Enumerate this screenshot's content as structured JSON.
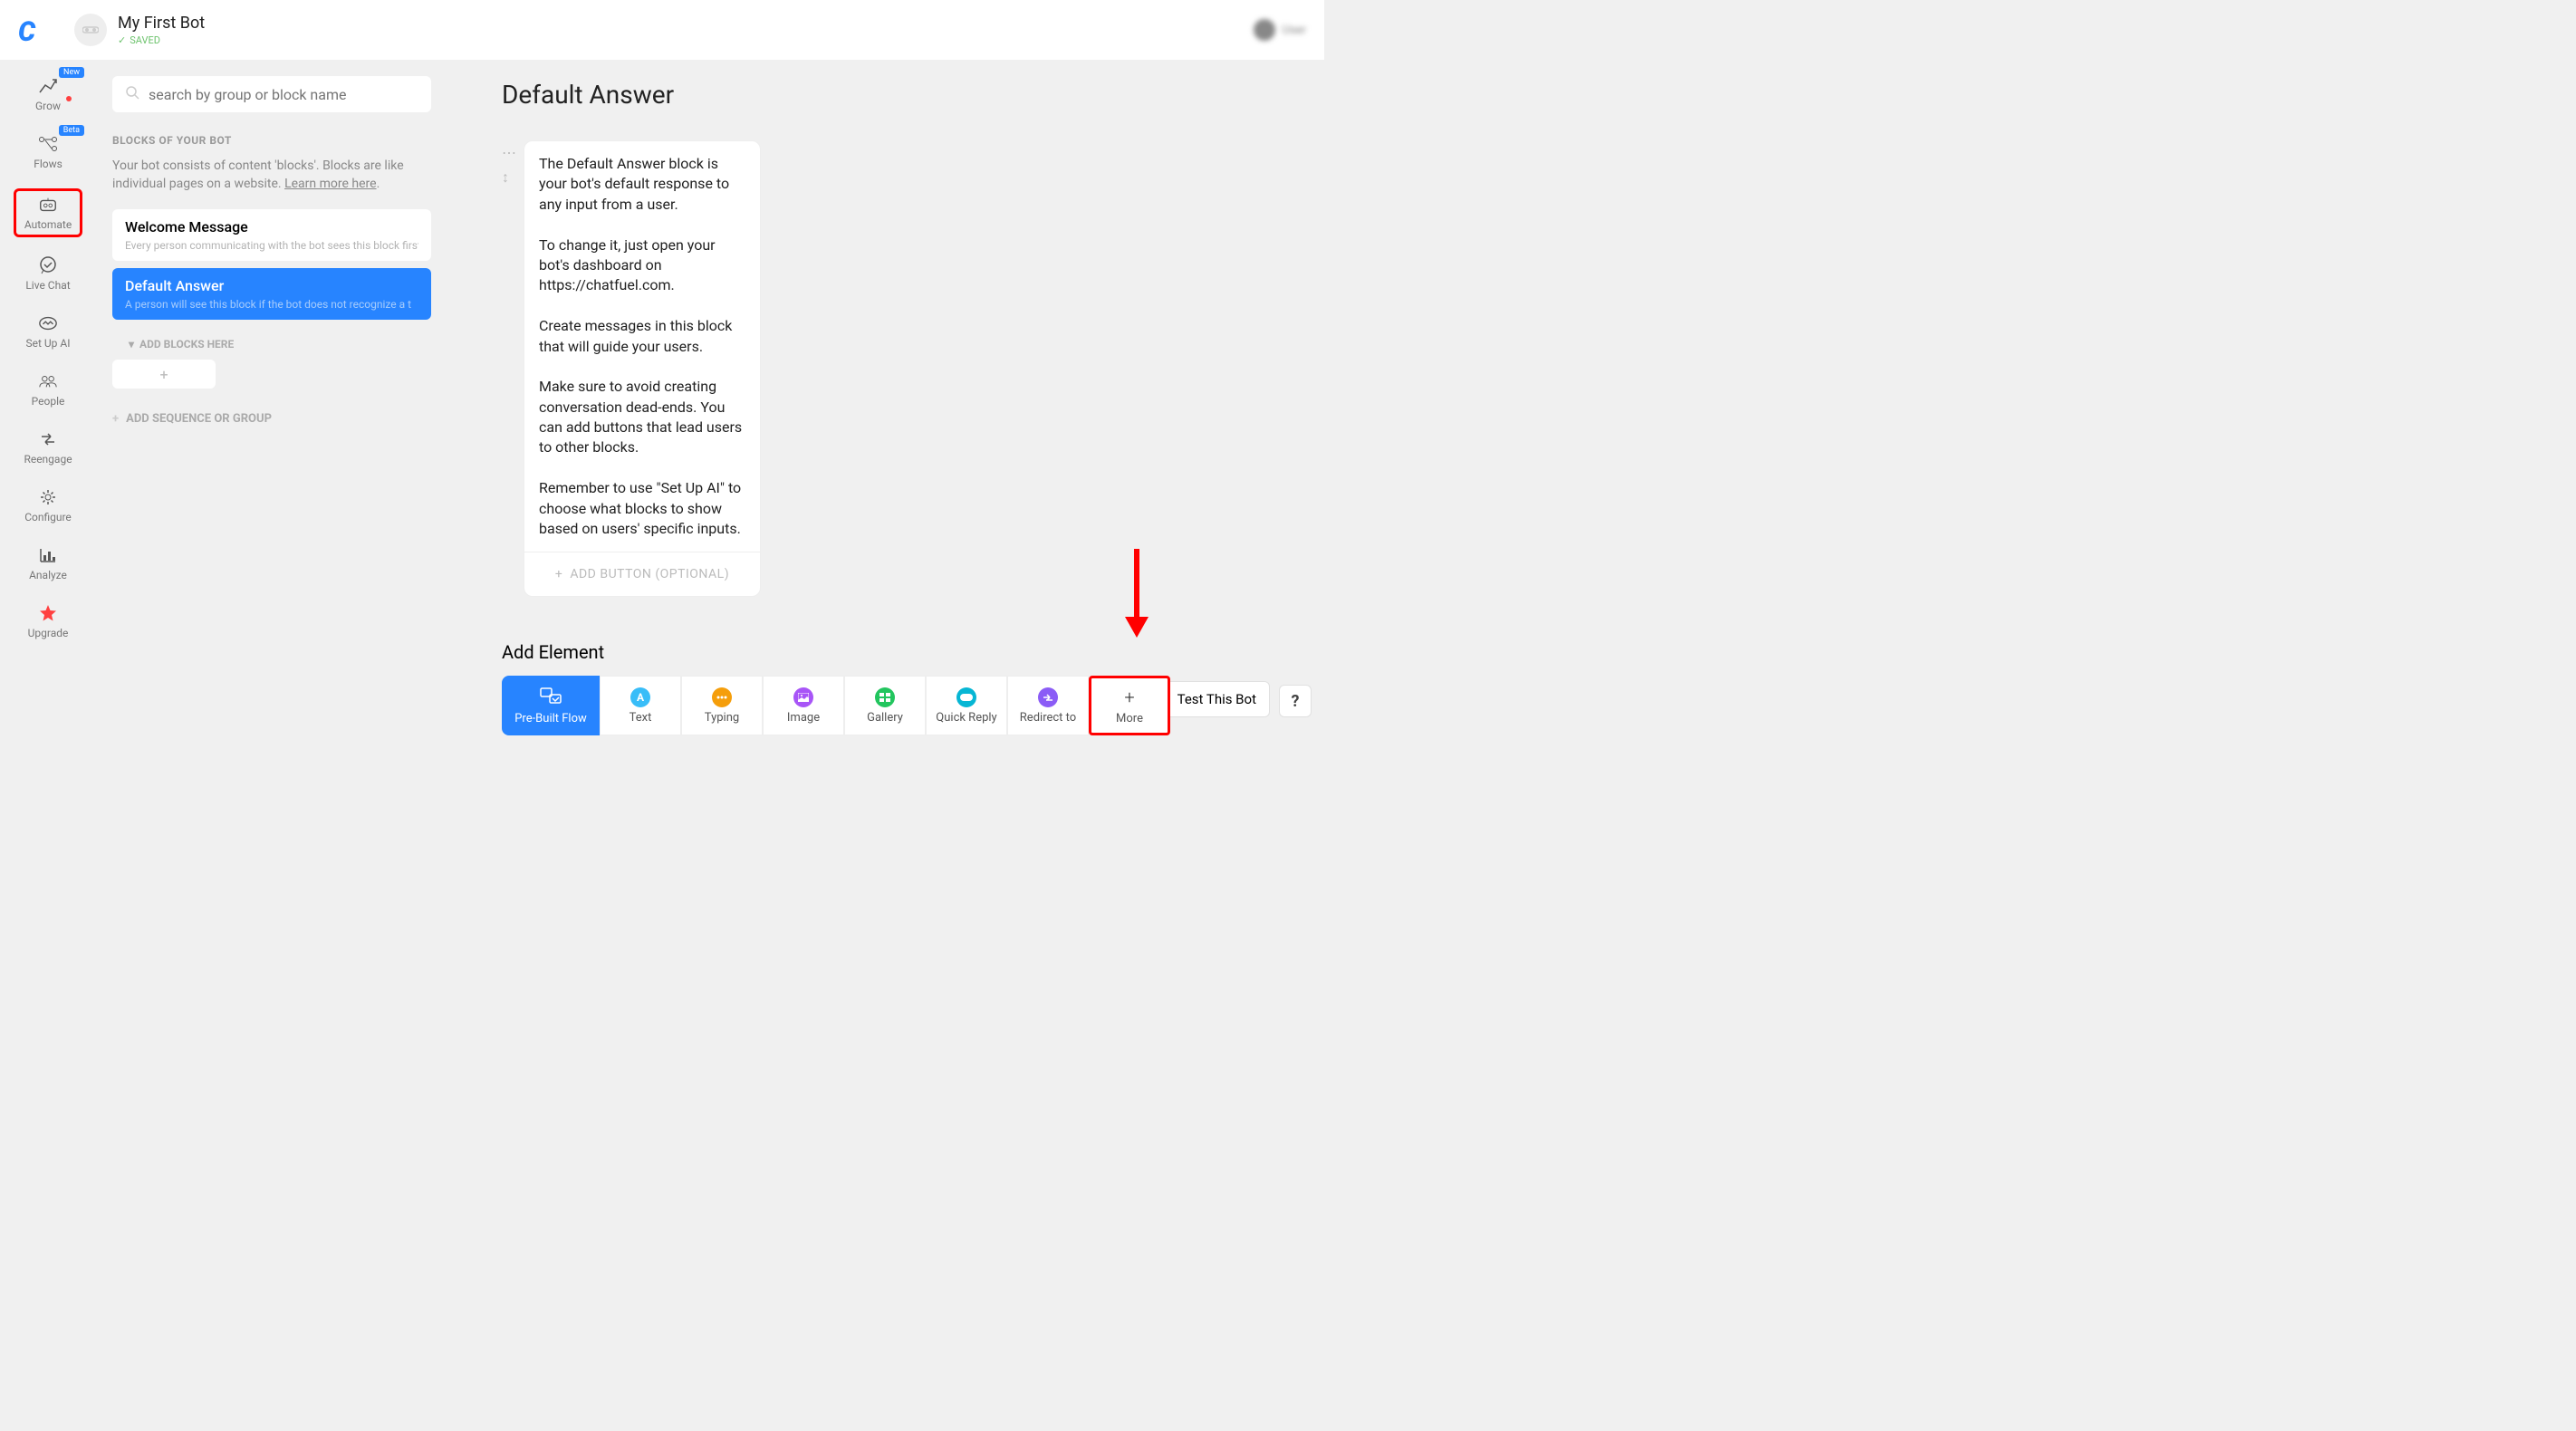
{
  "header": {
    "bot_title": "My First Bot",
    "saved_label": "SAVED",
    "user_name": "User"
  },
  "nav": {
    "items": [
      {
        "label": "Grow",
        "badge": "New"
      },
      {
        "label": "Flows",
        "badge": "Beta"
      },
      {
        "label": "Automate"
      },
      {
        "label": "Live Chat"
      },
      {
        "label": "Set Up AI"
      },
      {
        "label": "People"
      },
      {
        "label": "Reengage"
      },
      {
        "label": "Configure"
      },
      {
        "label": "Analyze"
      },
      {
        "label": "Upgrade"
      }
    ]
  },
  "blocks_panel": {
    "search_placeholder": "search by group or block name",
    "section_label": "BLOCKS OF YOUR BOT",
    "section_desc": "Your bot consists of content 'blocks'. Blocks are like individual pages on a website. ",
    "learn_more": "Learn more here",
    "blocks": [
      {
        "title": "Welcome Message",
        "subtitle": "Every person communicating with the bot sees this block first"
      },
      {
        "title": "Default Answer",
        "subtitle": "A person will see this block if the bot does not recognize a t"
      }
    ],
    "add_blocks_label": "ADD BLOCKS HERE",
    "add_seq_label": "ADD SEQUENCE OR GROUP"
  },
  "editor": {
    "title": "Default Answer",
    "text_content": "The Default Answer block is your bot's default response to any input from a user.\n\nTo change it, just open your bot's dashboard on https://chatfuel.com.\n\nCreate messages in this block that will guide your users.\n\nMake sure to avoid creating conversation dead-ends. You can add buttons that lead users to other blocks.\n\nRemember to use \"Set Up AI\" to choose what blocks to show based on users' specific inputs.",
    "add_button_label": "ADD BUTTON (OPTIONAL)",
    "add_element_title": "Add Element",
    "elements": [
      {
        "label": "Pre-Built Flow"
      },
      {
        "label": "Text"
      },
      {
        "label": "Typing"
      },
      {
        "label": "Image"
      },
      {
        "label": "Gallery"
      },
      {
        "label": "Quick Reply"
      },
      {
        "label": "Redirect to"
      },
      {
        "label": "More"
      }
    ]
  },
  "footer": {
    "test_bot_label": "Test This Bot",
    "help_label": "?"
  }
}
